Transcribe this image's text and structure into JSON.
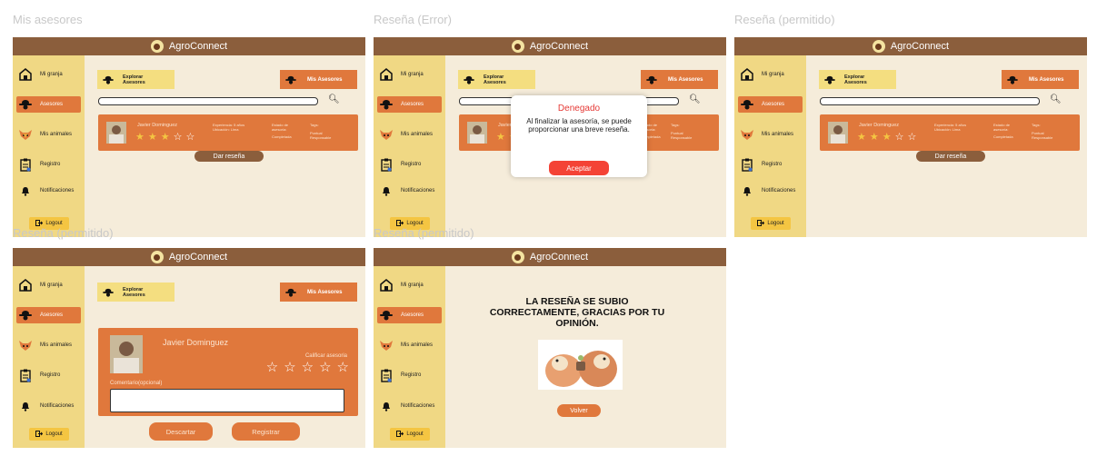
{
  "app": {
    "title": "AgroConnect"
  },
  "frames": {
    "f1": {
      "label": "Mis asesores"
    },
    "f2": {
      "label": "Reseña (Error)"
    },
    "f3": {
      "label": "Reseña (permitido)"
    },
    "f4": {
      "label": "Reseña (permitido)"
    },
    "f5": {
      "label": "Reseña (permitido)"
    }
  },
  "sidebar": {
    "items": [
      {
        "label": "Mi granja",
        "icon": "barn-icon"
      },
      {
        "label": "Asesores",
        "icon": "farmer-hat-icon"
      },
      {
        "label": "Mis animales",
        "icon": "animal-icon"
      },
      {
        "label": "Registro",
        "icon": "clipboard-icon"
      },
      {
        "label": "Notificaciones",
        "icon": "bell-icon"
      }
    ],
    "logout": "Logout"
  },
  "toolbar": {
    "explore_line1": "Explorar",
    "explore_line2": "Asesores",
    "mis_asesores": "Mis Asesores"
  },
  "advisor": {
    "name": "Javier Dominguez",
    "exp": "Experiencia: 5 años",
    "loc": "Ubicación: Lima",
    "state_label": "Estado de asesoría:",
    "state": "Completada",
    "tags_label": "Tags:",
    "tag1": "Puntual",
    "tag2": "Responsable",
    "rating": 3,
    "rating_max": 5
  },
  "review_button": "Dar reseña",
  "modal": {
    "title": "Denegado",
    "body": "Al finalizar la asesoría, se puede proporcionar una breve reseña.",
    "button": "Aceptar"
  },
  "review_form": {
    "rate_label": "Calificar asesoria",
    "comment_label": "Comentario(opcional)",
    "comment_value": "",
    "discard": "Descartar",
    "submit": "Registrar"
  },
  "success": {
    "message": "LA RESEÑA SE SUBIO CORRECTAMENTE, GRACIAS POR TU OPINIÓN.",
    "back": "Volver"
  },
  "colors": {
    "topbar": "#8b5e3c",
    "sidebar": "#f0d884",
    "accent": "#e0783c",
    "background": "#f5ecda",
    "error": "#f44336"
  }
}
